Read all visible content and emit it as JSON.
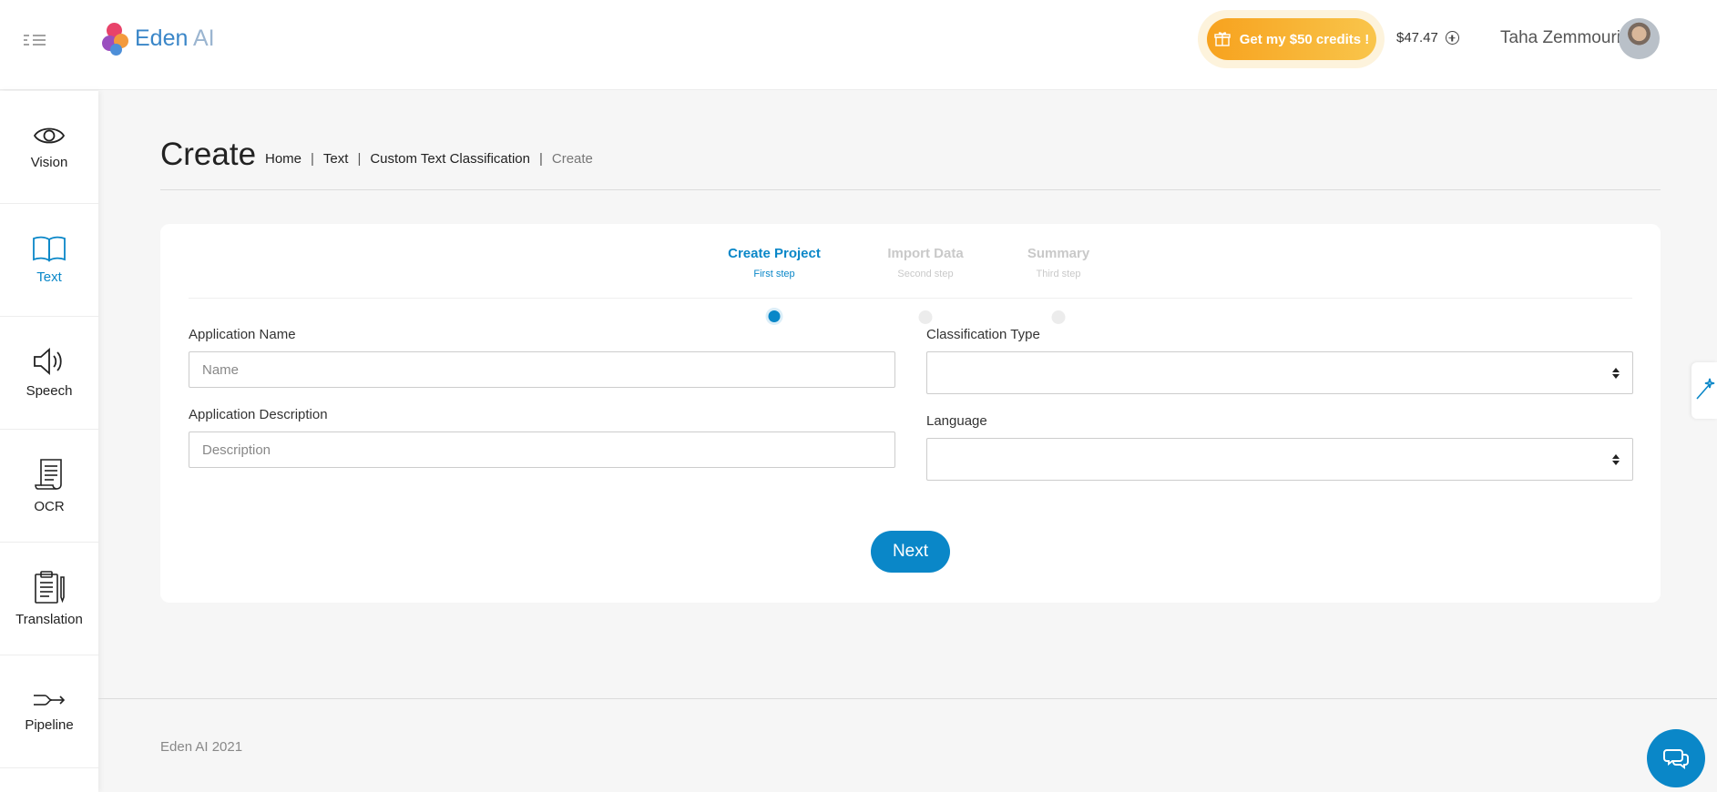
{
  "header": {
    "logo_text": "Eden",
    "logo_text_suffix": "AI",
    "credits_button": "Get my $50 credits !",
    "balance": "$47.47",
    "username": "Taha Zemmouri",
    "icons": {
      "menu": "menu-toggle-icon",
      "gift": "gift-icon",
      "add_credit": "plus-circle-icon",
      "avatar": "user-avatar"
    }
  },
  "sidebar": {
    "items": [
      {
        "label": "Vision",
        "icon": "eye-icon",
        "active": false
      },
      {
        "label": "Text",
        "icon": "book-icon",
        "active": true
      },
      {
        "label": "Speech",
        "icon": "speaker-icon",
        "active": false
      },
      {
        "label": "OCR",
        "icon": "scroll-icon",
        "active": false
      },
      {
        "label": "Translation",
        "icon": "clipboard-icon",
        "active": false
      },
      {
        "label": "Pipeline",
        "icon": "pipeline-icon",
        "active": false
      }
    ]
  },
  "page": {
    "title": "Create",
    "breadcrumb": [
      "Home",
      "Text",
      "Custom Text Classification",
      "Create"
    ]
  },
  "wizard": {
    "steps": [
      {
        "title": "Create Project",
        "subtitle": "First step",
        "state": "active"
      },
      {
        "title": "Import Data",
        "subtitle": "Second step",
        "state": "inactive"
      },
      {
        "title": "Summary",
        "subtitle": "Third step",
        "state": "inactive"
      }
    ]
  },
  "form": {
    "app_name_label": "Application Name",
    "app_name_placeholder": "Name",
    "app_name_value": "",
    "app_desc_label": "Application Description",
    "app_desc_placeholder": "Description",
    "app_desc_value": "",
    "classification_type_label": "Classification Type",
    "classification_type_value": "",
    "language_label": "Language",
    "language_value": "",
    "next_button": "Next"
  },
  "footer": {
    "text": "Eden AI 2021"
  },
  "colors": {
    "accent": "#0a87c8",
    "credits_gradient_start": "#f7a21e",
    "credits_gradient_end": "#f9c54b",
    "background": "#f6f6f6"
  },
  "floating": {
    "wand_icon": "magic-wand-icon",
    "chat_icon": "chat-bubbles-icon"
  }
}
